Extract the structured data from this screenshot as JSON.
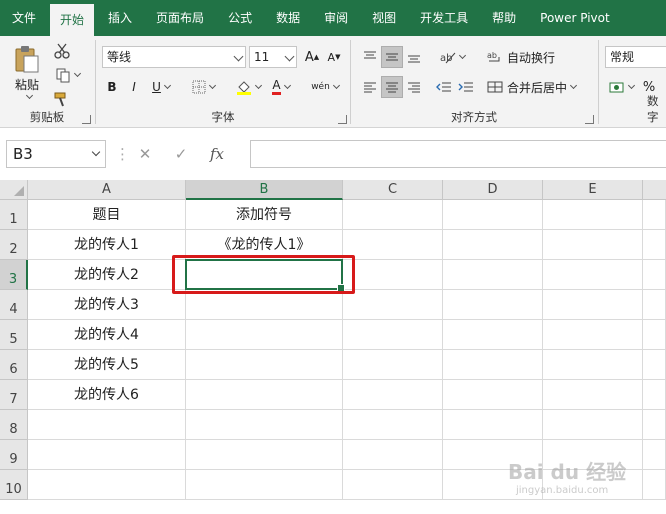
{
  "tabs": [
    "文件",
    "开始",
    "插入",
    "页面布局",
    "公式",
    "数据",
    "审阅",
    "视图",
    "开发工具",
    "帮助",
    "Power Pivot"
  ],
  "active_tab_index": 1,
  "ribbon": {
    "clipboard": {
      "paste_label": "粘贴",
      "group_label": "剪贴板"
    },
    "font": {
      "font_name": "等线",
      "font_size": "11",
      "grow": "A",
      "shrink": "A",
      "bold": "B",
      "italic": "I",
      "underline": "U",
      "font_color_letter": "A",
      "phonetic": "wén",
      "group_label": "字体"
    },
    "alignment": {
      "wrap_text": "自动换行",
      "merge_center": "合并后居中",
      "group_label": "对齐方式"
    },
    "number": {
      "format": "常规",
      "percent": "%",
      "group_label": "数字"
    }
  },
  "formula_bar": {
    "name_box": "B3",
    "fx": "fx",
    "cancel": "✕",
    "confirm": "✓",
    "formula": ""
  },
  "columns": [
    "A",
    "B",
    "C",
    "D",
    "E"
  ],
  "selected_column": "B",
  "rows": [
    "1",
    "2",
    "3",
    "4",
    "5",
    "6",
    "7",
    "8",
    "9",
    "10"
  ],
  "selected_row": "3",
  "cells": {
    "A1": "题目",
    "B1": "添加符号",
    "A2": "龙的传人1",
    "B2": "《龙的传人1》",
    "A3": "龙的传人2",
    "A4": "龙的传人3",
    "A5": "龙的传人4",
    "A6": "龙的传人5",
    "A7": "龙的传人6"
  },
  "watermark": {
    "brand": "Bai du 经验",
    "url": "jingyan.baidu.com"
  },
  "colors": {
    "excel_green": "#217346",
    "highlight_red": "#d71a1a"
  }
}
